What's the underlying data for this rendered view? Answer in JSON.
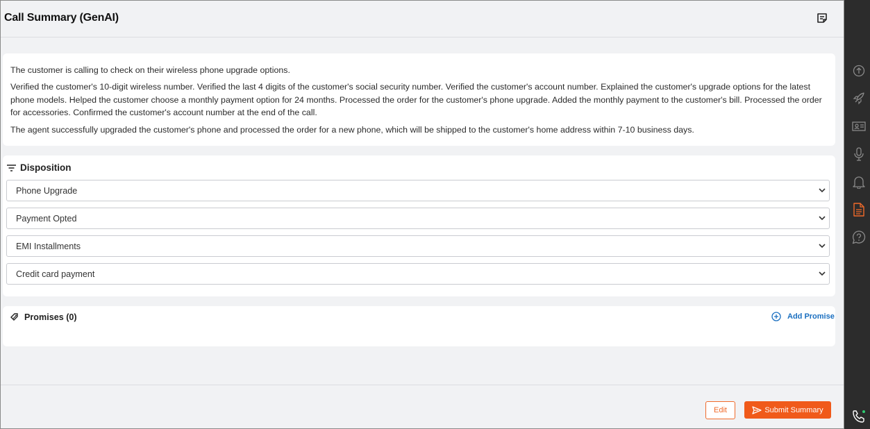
{
  "header": {
    "title": "Call Summary (GenAI)",
    "icon": "notes-icon"
  },
  "summary": {
    "paragraphs": [
      "The customer is calling to check on their wireless phone upgrade options.",
      "Verified the customer's 10-digit wireless number. Verified the last 4 digits of the customer's social security number. Verified the customer's account number. Explained the customer's upgrade options for the latest phone models. Helped the customer choose a monthly payment option for 24 months. Processed the order for the customer's phone upgrade. Added the monthly payment to the customer's bill. Processed the order for accessories. Confirmed the customer's account number at the end of the call.",
      "The agent successfully upgraded the customer's phone and processed the order for a new phone, which will be shipped to the customer's home address within 7-10 business days."
    ]
  },
  "disposition": {
    "title": "Disposition",
    "selects": [
      "Phone Upgrade",
      "Payment Opted",
      "EMI Installments",
      "Credit card payment"
    ]
  },
  "promises": {
    "title": "Promises (0)",
    "add_label": "Add Promise"
  },
  "footer": {
    "edit_label": "Edit",
    "submit_label": "Submit Summary"
  },
  "sidebar": {
    "icons": [
      "upload-circle-icon",
      "rocket-icon",
      "contact-card-icon",
      "microphone-icon",
      "bell-icon",
      "document-icon",
      "help-chat-icon",
      "phone-icon"
    ],
    "active_color": "#f06a2a",
    "icon_color": "#8a8a8a"
  },
  "colors": {
    "accent": "#f05a1a",
    "link": "#1a6fc0"
  }
}
